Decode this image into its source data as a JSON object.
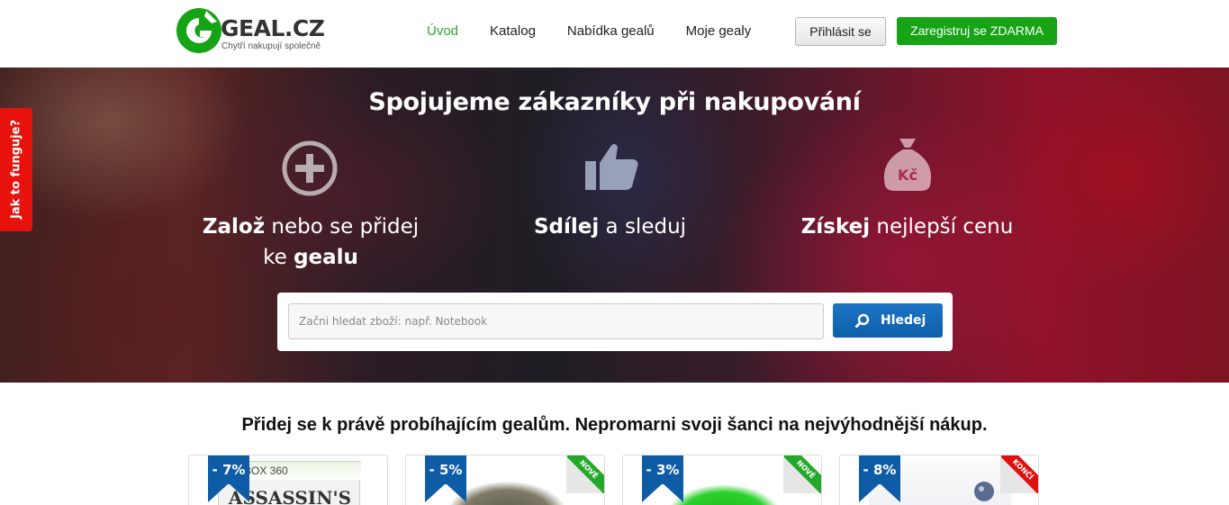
{
  "header": {
    "logo_text": "GEAL.CZ",
    "tagline": "Chytří nakupují společně",
    "nav": [
      {
        "label": "Úvod",
        "active": true
      },
      {
        "label": "Katalog",
        "active": false
      },
      {
        "label": "Nabídka gealů",
        "active": false
      },
      {
        "label": "Moje gealy",
        "active": false
      }
    ],
    "login_label": "Přihlásit se",
    "register_label": "Zaregistruj se ZDARMA"
  },
  "hero": {
    "title": "Spojujeme zákazníky při nakupování",
    "features": [
      {
        "icon": "plus-circle-icon",
        "bold1": "Založ",
        "text1": " nebo se přidej",
        "text2": "ke ",
        "bold2": "gealu"
      },
      {
        "icon": "thumbs-up-icon",
        "bold1": "Sdílej",
        "text1": " a sleduj"
      },
      {
        "icon": "money-bag-icon",
        "icon_text": "Kč",
        "bold1": "Získej",
        "text1": " nejlepší cenu"
      }
    ],
    "search_placeholder": "Začni hledat zboží: např. Notebook",
    "search_button": "Hledej"
  },
  "side_tab": "Jak to funguje?",
  "section_title": "Přidej se k právě probíhajícím gealům. Nepromarni svoji šanci na nejvýhodnější nákup.",
  "cards": [
    {
      "discount": "- 7%",
      "ribbon": "",
      "image_text_1": "BOX 360",
      "image_text_2": "ASSASSIN'S"
    },
    {
      "discount": "- 5%",
      "ribbon": "NOVÉ"
    },
    {
      "discount": "- 3%",
      "ribbon": "NOVÉ"
    },
    {
      "discount": "- 8%",
      "ribbon": "KONČÍ"
    }
  ],
  "colors": {
    "brand_green": "#16a316",
    "active_nav": "#2aa52a",
    "search_blue": "#0d5fa8",
    "side_tab_red": "#e8120c",
    "discount_blue": "#0f5ca6"
  }
}
